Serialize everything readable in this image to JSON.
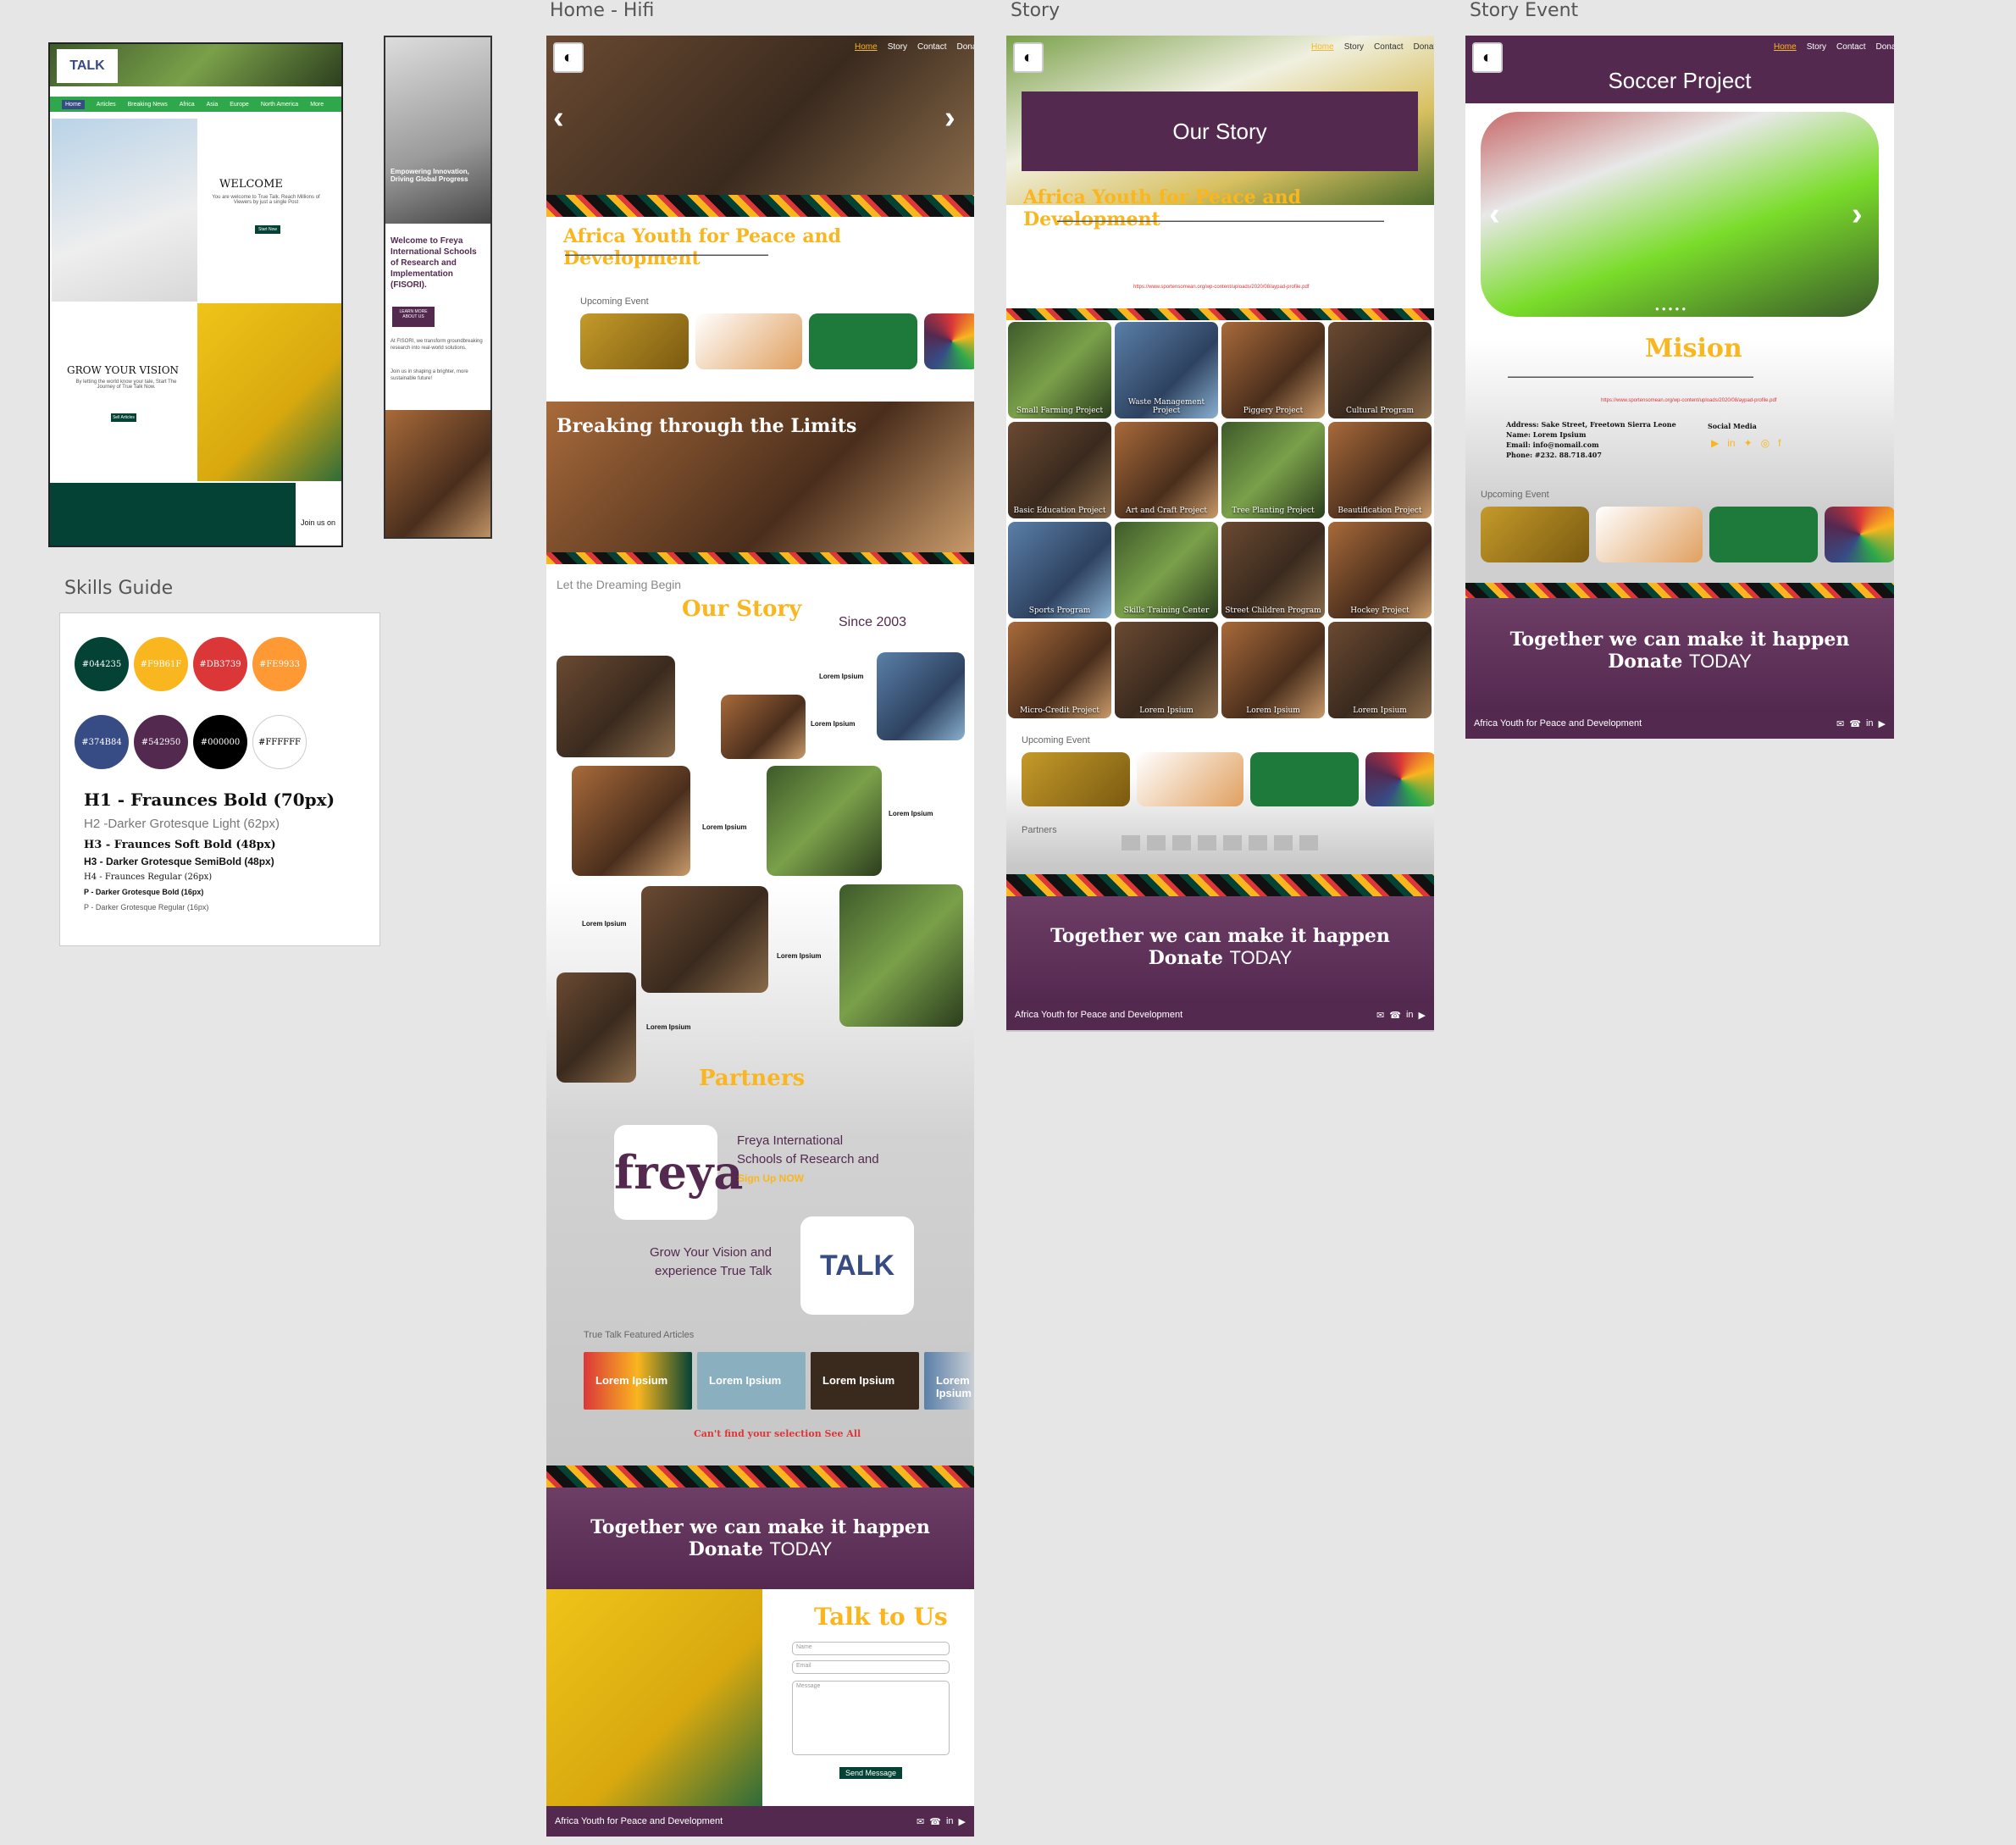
{
  "frames": {
    "home_hifi": "Home - Hifi",
    "story": "Story",
    "story_event": "Story Event",
    "skills_guide": "Skills Guide"
  },
  "nav": [
    "Home",
    "Story",
    "Contact",
    "Donate"
  ],
  "truetalk": {
    "menu": [
      "Home",
      "Articles",
      "Breaking News",
      "Africa",
      "Asia",
      "Europe",
      "North America",
      "More"
    ],
    "welcome_title": "WELCOME",
    "welcome_text": "You are welcome to True Talk. Reach Millions of Viewers by just a single Post",
    "welcome_btn": "Start Now",
    "grow_title": "GROW YOUR VISION",
    "grow_text": "By letting the world know your tale, Start The Journey of True Talk Now.",
    "grow_btn": "Sell Articles",
    "join": "Join us on"
  },
  "freya_mobile": {
    "hero": "Empowering Innovation, Driving Global Progress",
    "welcome": "Welcome to Freya International Schools of Research and Implementation (FISORI).",
    "btn": "LEARN MORE ABOUT US",
    "text1": "At FISORI, we transform groundbreaking research into real-world solutions.",
    "text2": "Join us in shaping a brighter, more sustainable future!"
  },
  "home": {
    "title": "Africa Youth for Peace and Development",
    "upcoming": "Upcoming Event",
    "breaking": "Breaking through the Limits",
    "dreaming": "Let the Dreaming Begin",
    "our_story": "Our Story",
    "since": "Since 2003",
    "lorem": "Lorem Ipsium",
    "partners": "Partners",
    "freya_line1": "Freya International",
    "freya_line2": "Schools of Research and",
    "signup": "Sign Up NOW",
    "grow1": "Grow Your Vision and",
    "grow2": "experience True Talk",
    "featured": "True Talk Featured Articles",
    "see_all": "Can't find your selection See All",
    "together": "Together we can make it happen",
    "donate": "Donate",
    "today": "TODAY",
    "talk": "Talk to Us",
    "name_ph": "Name",
    "email_ph": "Email",
    "message_ph": "Message",
    "send": "Send Message",
    "footer": "Africa Youth for Peace and Development"
  },
  "story": {
    "title": "Our Story",
    "subtitle": "Africa Youth for Peace and Development",
    "link": "https://www.sportensomean.org/wp-content/uploads/2020/08/aypad-profile.pdf",
    "projects": [
      "Small Farming Project",
      "Waste Management Project",
      "Piggery Project",
      "Cultural Program",
      "Basic Education Project",
      "Art and Craft Project",
      "Tree Planting Project",
      "Beautification Project",
      "Sports Program",
      "Skills Training Center",
      "Street Children Program",
      "Hockey Project",
      "Micro-Credit Project",
      "Lorem Ipsium",
      "Lorem Ipsium",
      "Lorem Ipsium"
    ],
    "upcoming": "Upcoming Event",
    "partners": "Partners",
    "together": "Together we can make it happen",
    "donate": "Donate",
    "today": "TODAY",
    "footer": "Africa Youth for Peace and Development"
  },
  "event": {
    "title": "Soccer Project",
    "mision": "Mision",
    "link": "https://www.sportensomean.org/wp-content/uploads/2020/08/aypad-profile.pdf",
    "address": "Address: Sake Street, Freetown Sierra Leone",
    "name": "Name: Lorem Ipsium",
    "email": "Email: info@nomail.com",
    "phone": "Phone: #232. 88.718.407",
    "social": "Social Media",
    "upcoming": "Upcoming Event",
    "together": "Together we can make it happen",
    "donate": "Donate",
    "today": "TODAY",
    "footer": "Africa Youth for Peace and Development"
  },
  "skills": {
    "swatches": [
      "#044235",
      "#F9B61F",
      "#DB3739",
      "#FE9933",
      "#374B84",
      "#542950",
      "#000000",
      "#FFFFFF"
    ],
    "h1": "H1 - Fraunces Bold (70px)",
    "h2": "H2 -Darker Grotesque Light (62px)",
    "h3a": "H3 - Fraunces Soft Bold (48px)",
    "h3b": "H3 - Darker Grotesque SemiBold (48px)",
    "h4": "H4 - Fraunces Regular (26px)",
    "p1": "P - Darker Grotesque Bold (16px)",
    "p2": "P - Darker Grotesque Regular (16px)"
  },
  "colors": {
    "green": "#044235",
    "gold": "#F9B61F",
    "red": "#DB3739",
    "purple": "#542950"
  }
}
